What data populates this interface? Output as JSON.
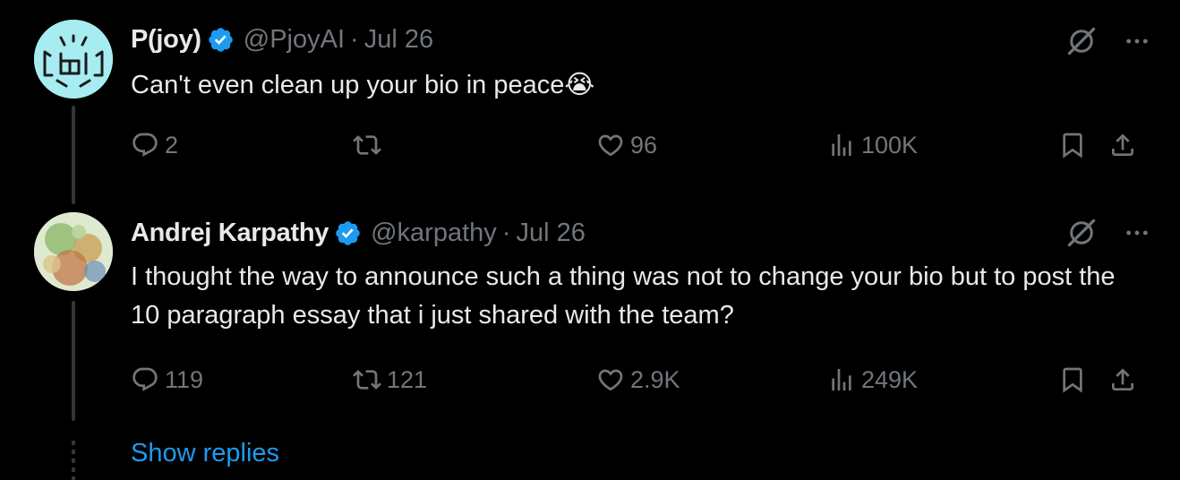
{
  "tweets": [
    {
      "author_name": "P(joy)",
      "handle": "@PjoyAI",
      "separator": "·",
      "date": "Jul 26",
      "text": "Can't even clean up your bio in peace",
      "emoji": "😭",
      "replies": "2",
      "retweets": "",
      "likes": "96",
      "views": "100K"
    },
    {
      "author_name": "Andrej Karpathy",
      "handle": "@karpathy",
      "separator": "·",
      "date": "Jul 26",
      "text": "I thought the way to announce such a thing was not to change your bio but to post the 10 paragraph essay that i just shared with the team?",
      "replies": "119",
      "retweets": "121",
      "likes": "2.9K",
      "views": "249K"
    }
  ],
  "show_replies": "Show replies",
  "colors": {
    "background": "#000000",
    "text": "#e7e9ea",
    "secondary": "#71767b",
    "accent": "#1d9bf0"
  },
  "icons": [
    "verified-badge-icon",
    "grok-icon",
    "more-icon",
    "reply-icon",
    "retweet-icon",
    "like-icon",
    "views-icon",
    "bookmark-icon",
    "share-icon"
  ]
}
